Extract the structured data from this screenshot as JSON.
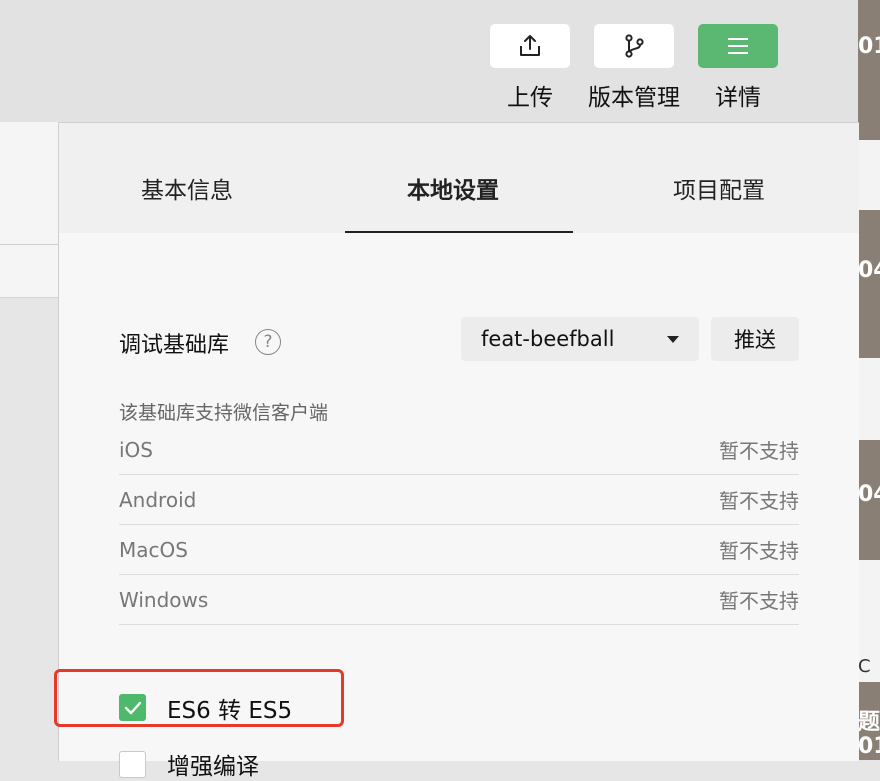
{
  "toolbar": {
    "upload_label": "上传",
    "version_label": "版本管理",
    "details_label": "详情",
    "details_accent": "#5bb872"
  },
  "tabs": [
    {
      "label": "基本信息",
      "active": false
    },
    {
      "label": "本地设置",
      "active": true
    },
    {
      "label": "项目配置",
      "active": false
    }
  ],
  "debug_lib": {
    "label": "调试基础库",
    "help_icon": "?",
    "selected_value": "feat-beefball",
    "push_label": "推送"
  },
  "support": {
    "label": "该基础库支持微信客户端",
    "platforms": [
      {
        "name": "iOS",
        "status": "暂不支持"
      },
      {
        "name": "Android",
        "status": "暂不支持"
      },
      {
        "name": "MacOS",
        "status": "暂不支持"
      },
      {
        "name": "Windows",
        "status": "暂不支持"
      }
    ]
  },
  "options": {
    "es6_label": "ES6 转 ES5",
    "es6_checked": true,
    "incremental_label": "增强编译",
    "incremental_checked": false
  },
  "desktop_fragments": [
    "01",
    "04",
    "04",
    "题",
    "01",
    "C"
  ],
  "colors": {
    "checkbox_green": "#4fb96b",
    "highlight_red": "#e53a2a"
  }
}
